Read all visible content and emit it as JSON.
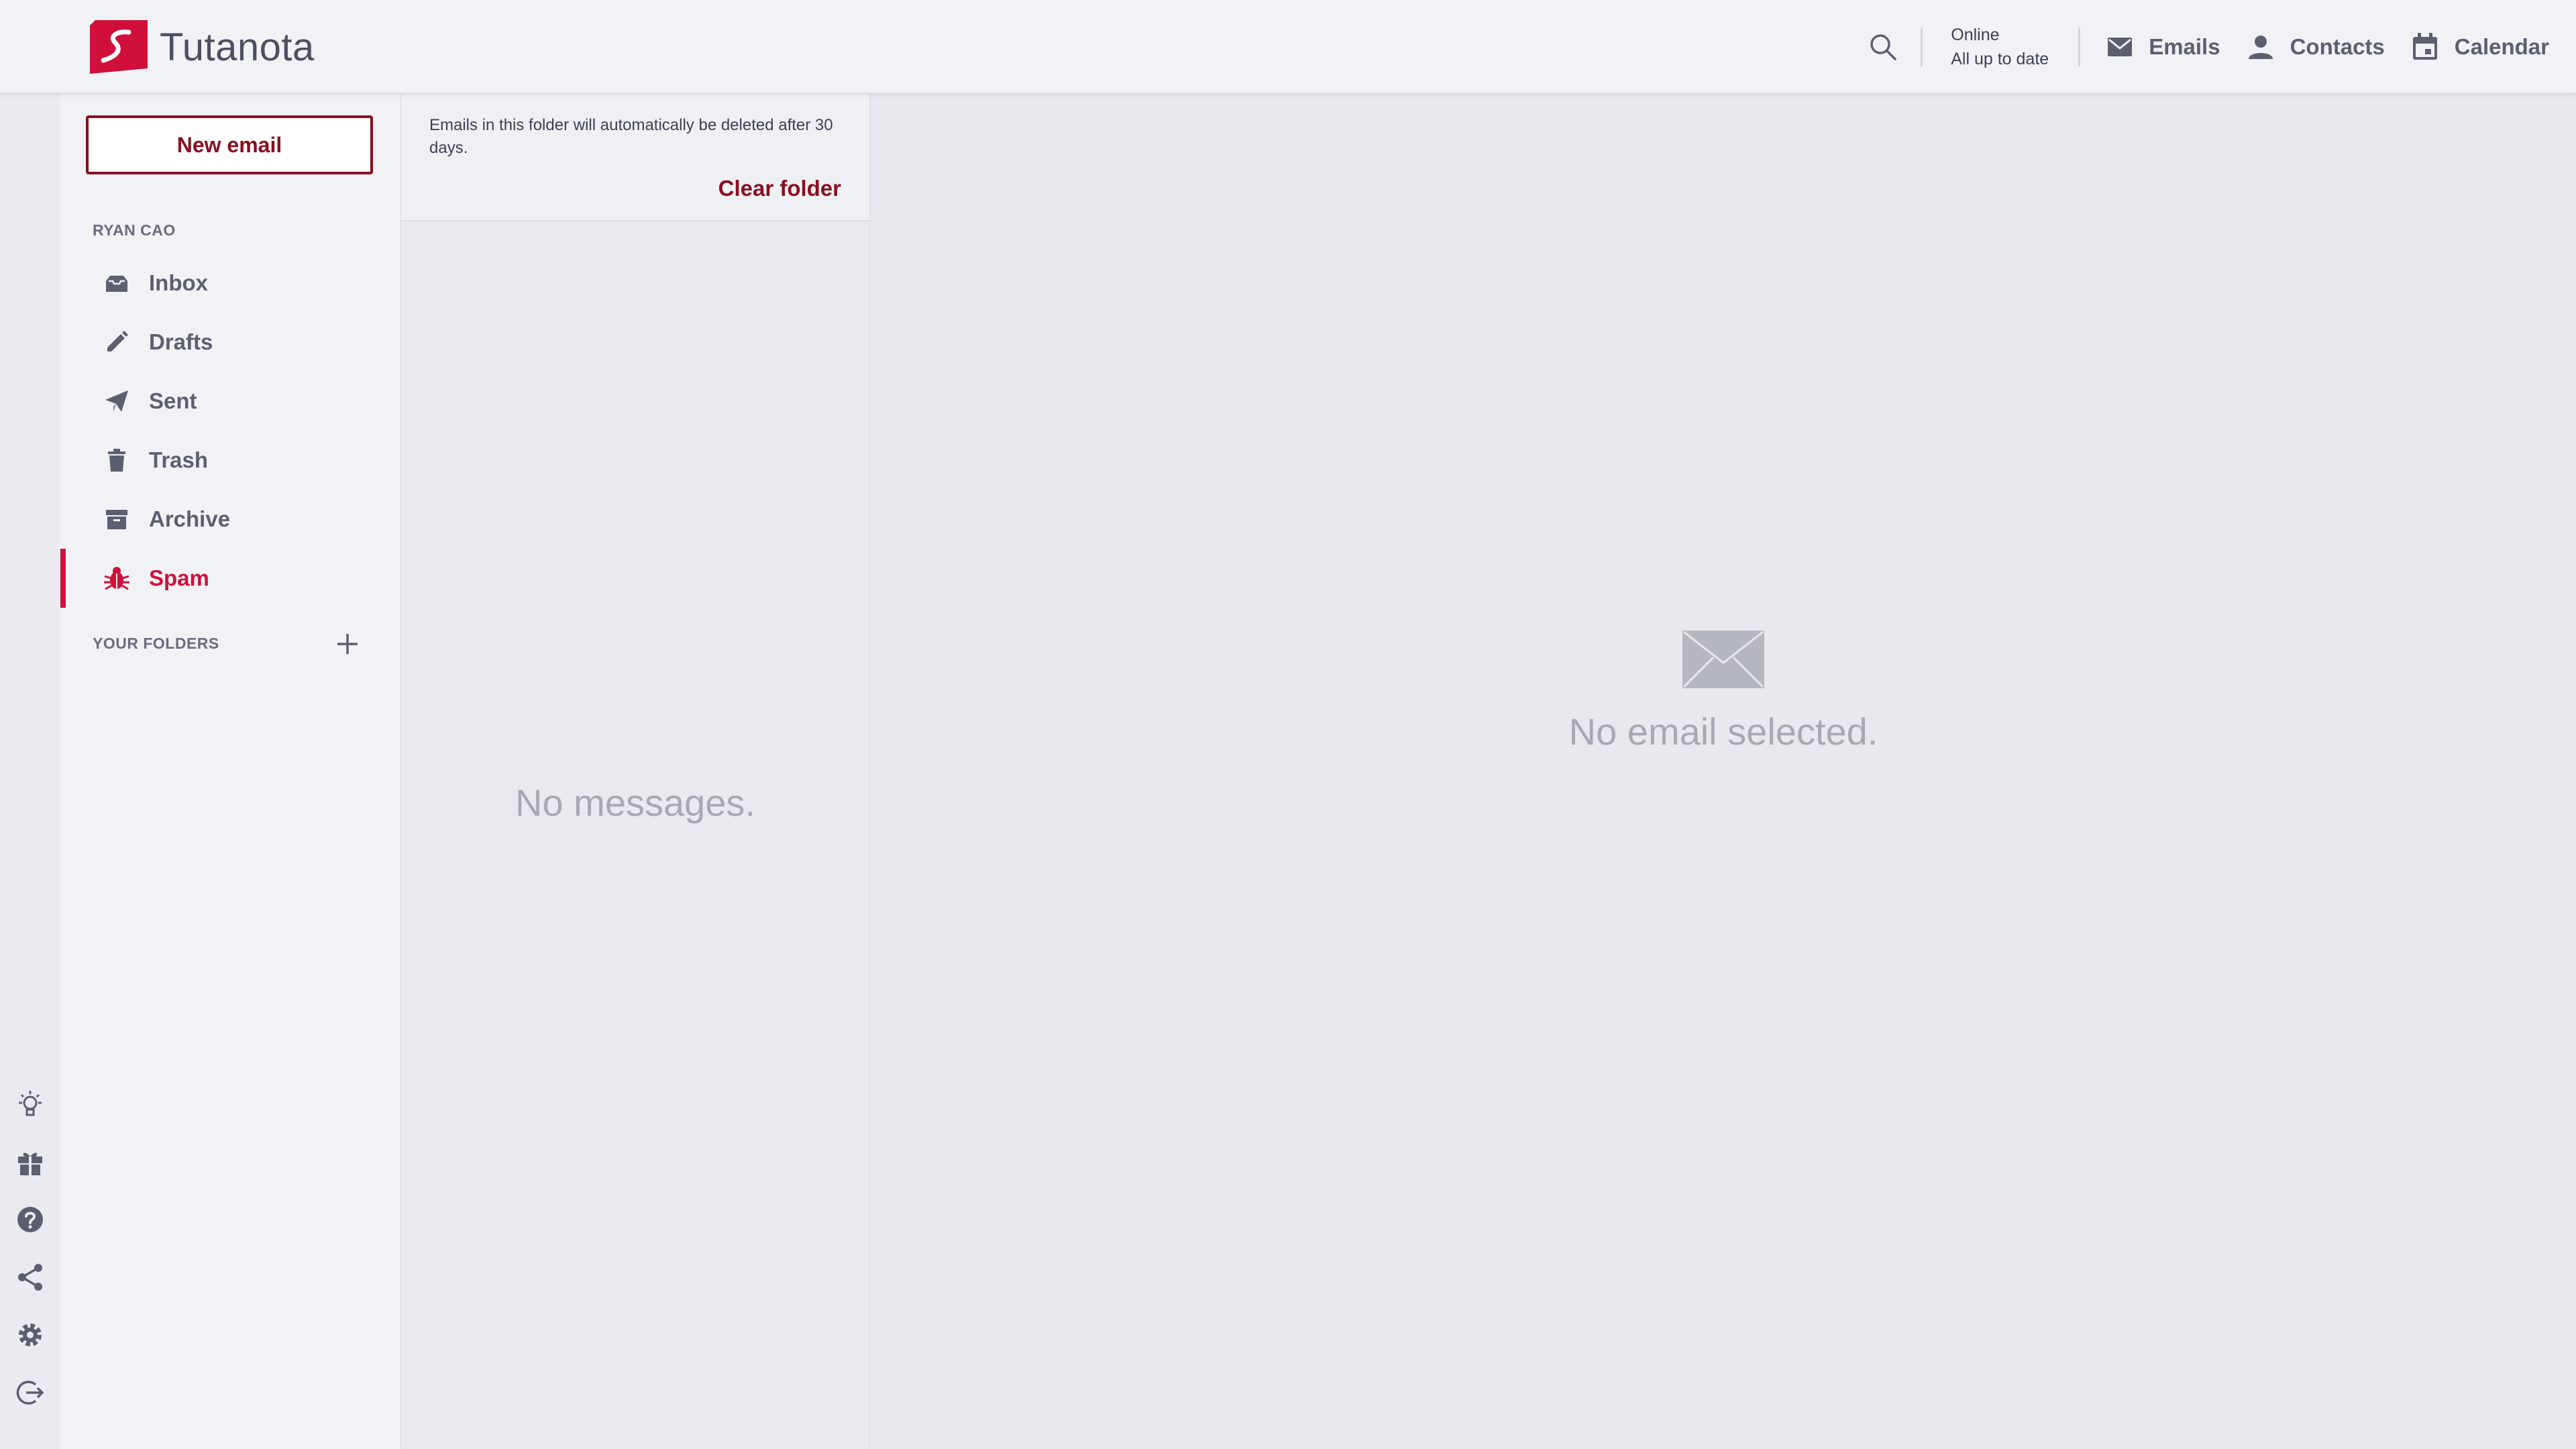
{
  "app": {
    "logo_text": "Tutanota",
    "brand_color": "#d0103a",
    "dark_red": "#8a0f1f"
  },
  "header": {
    "status_line1": "Online",
    "status_line2": "All up to date",
    "nav": [
      {
        "label": "Emails",
        "icon": "mail-icon"
      },
      {
        "label": "Contacts",
        "icon": "person-icon"
      },
      {
        "label": "Calendar",
        "icon": "calendar-icon"
      }
    ]
  },
  "sidebar": {
    "new_email_label": "New email",
    "account_label": "RYAN CAO",
    "folders": [
      {
        "label": "Inbox",
        "icon": "inbox-icon"
      },
      {
        "label": "Drafts",
        "icon": "pencil-icon"
      },
      {
        "label": "Sent",
        "icon": "paper-plane-icon"
      },
      {
        "label": "Trash",
        "icon": "trash-icon"
      },
      {
        "label": "Archive",
        "icon": "archive-icon"
      },
      {
        "label": "Spam",
        "icon": "bug-icon",
        "active": true
      }
    ],
    "your_folders_label": "YOUR FOLDERS"
  },
  "rail": {
    "icons": [
      "lightbulb-icon",
      "gift-icon",
      "help-icon",
      "share-icon",
      "settings-icon",
      "logout-icon"
    ]
  },
  "list": {
    "notice": "Emails in this folder will automatically be deleted after 30 days.",
    "clear_folder_label": "Clear folder",
    "empty_text": "No messages."
  },
  "viewer": {
    "empty_text": "No email selected."
  }
}
